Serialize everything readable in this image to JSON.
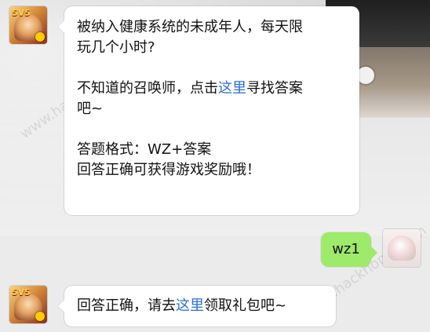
{
  "bot_avatar": {
    "icon": "game-avatar-icon",
    "badge_text": "5V5"
  },
  "user_avatar": {
    "icon": "user-avatar-icon"
  },
  "watermark": {
    "text": "www.hackhome.com"
  },
  "messages": {
    "question": {
      "line1": "被纳入健康系统的未成年人，每天限",
      "line2": "玩几个小时?",
      "hint_prefix": "不知道的召唤师，点击",
      "hint_link": "这里",
      "hint_suffix_1": "寻找答案",
      "hint_suffix_2": "吧~",
      "format_line": "答题格式：WZ+答案",
      "reward_line": "回答正确可获得游戏奖励哦！"
    },
    "reply": {
      "text": "wz1"
    },
    "result": {
      "prefix": "回答正确，请去",
      "link": "这里",
      "suffix": "领取礼包吧~"
    }
  },
  "colors": {
    "link": "#2a6fd6",
    "reply_bubble": "#9eea6a",
    "background": "#ebebeb"
  }
}
